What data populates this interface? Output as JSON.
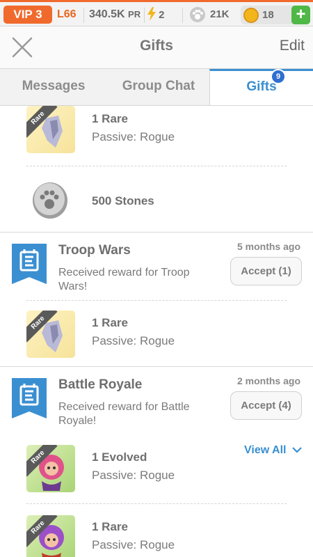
{
  "status_bar": {
    "vip": "VIP 3",
    "level": "L66",
    "power": "340.5K",
    "power_unit": "PR",
    "energy": "2",
    "stones": "21K",
    "gold": "18",
    "add_gold": "+",
    "accent_color": "#ef6a2b"
  },
  "header": {
    "title": "Gifts",
    "edit_label": "Edit"
  },
  "tabs": [
    {
      "label": "Messages"
    },
    {
      "label": "Group Chat"
    },
    {
      "label": "Gifts",
      "badge": "9"
    }
  ],
  "gifts": {
    "top_rewards": [
      {
        "badge": "Rare",
        "name": "1 Rare",
        "detail": "Passive: Rogue"
      },
      {
        "name": "500 Stones"
      }
    ],
    "messages": [
      {
        "title": "Troop Wars",
        "time": "5 months ago",
        "description": "Received reward for Troop Wars!",
        "accept_label": "Accept (1)",
        "rewards": [
          {
            "badge": "Rare",
            "name": "1 Rare",
            "detail": "Passive: Rogue"
          }
        ]
      },
      {
        "title": "Battle Royale",
        "time": "2 months ago",
        "description": "Received reward for Battle Royale!",
        "accept_label": "Accept (4)",
        "view_all": "View All",
        "rewards": [
          {
            "badge": "Rare",
            "name": "1 Evolved",
            "detail": "Passive: Rogue"
          },
          {
            "badge": "Rare",
            "name": "1 Rare",
            "detail": "Passive: Rogue"
          }
        ]
      }
    ]
  }
}
